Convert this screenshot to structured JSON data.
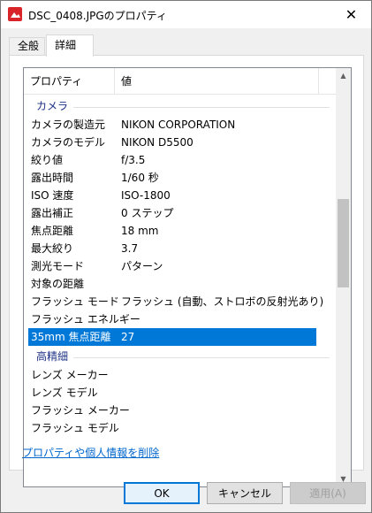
{
  "window": {
    "title": "DSC_0408.JPGのプロパティ",
    "close_glyph": "✕"
  },
  "tabs": [
    {
      "label": "全般"
    },
    {
      "label": "詳細"
    }
  ],
  "table": {
    "headers": {
      "property": "プロパティ",
      "value": "値"
    },
    "groups": [
      {
        "label": "カメラ",
        "rows": [
          {
            "k": "カメラの製造元",
            "v": "NIKON CORPORATION"
          },
          {
            "k": "カメラのモデル",
            "v": "NIKON D5500"
          },
          {
            "k": "絞り値",
            "v": "f/3.5"
          },
          {
            "k": "露出時間",
            "v": "1/60 秒"
          },
          {
            "k": "ISO 速度",
            "v": "ISO-1800"
          },
          {
            "k": "露出補正",
            "v": "0 ステップ"
          },
          {
            "k": "焦点距離",
            "v": "18 mm"
          },
          {
            "k": "最大絞り",
            "v": "3.7"
          },
          {
            "k": "測光モード",
            "v": "パターン"
          },
          {
            "k": "対象の距離",
            "v": ""
          },
          {
            "k": "フラッシュ モード",
            "v": "フラッシュ (自動、ストロボの反射光あり)"
          },
          {
            "k": "フラッシュ エネルギー",
            "v": ""
          },
          {
            "k": "35mm 焦点距離",
            "v": "27",
            "selected": true
          }
        ]
      },
      {
        "label": "高精細",
        "rows": [
          {
            "k": "レンズ メーカー",
            "v": ""
          },
          {
            "k": "レンズ モデル",
            "v": ""
          },
          {
            "k": "フラッシュ メーカー",
            "v": ""
          },
          {
            "k": "フラッシュ モデル",
            "v": ""
          }
        ]
      }
    ]
  },
  "link": "プロパティや個人情報を削除",
  "buttons": {
    "ok": "OK",
    "cancel": "キャンセル",
    "apply": "適用(A)"
  },
  "colors": {
    "accent": "#0078d7",
    "link": "#0066cc",
    "group_label": "#1e3287"
  }
}
